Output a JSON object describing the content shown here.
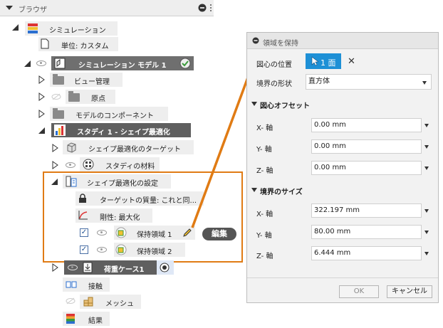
{
  "browser": {
    "title": "ブラウザ",
    "items": {
      "simulation": "シミュレーション",
      "units": "単位: カスタム",
      "model": "シミュレーション モデル 1",
      "view_mgmt": "ビュー管理",
      "origin": "原点",
      "model_components": "モデルのコンポーネント",
      "study": "スタディ 1 - シェイプ最適化",
      "shape_target": "シェイプ最適化のターゲット",
      "study_material": "スタディの材料",
      "shape_settings": "シェイプ最適化の設定",
      "target_mass": "ターゲットの質量: これと同...",
      "stiffness": "剛性: 最大化",
      "preserve1": "保持領域 1",
      "preserve2": "保持領域 2",
      "load_case": "荷重ケース1",
      "contact": "接触",
      "mesh": "メッシュ",
      "results": "結果"
    },
    "edit_callout": "編集",
    "check_mark": "✓"
  },
  "dialog": {
    "title": "領域を保持",
    "centroid_label": "図心の位置",
    "face_button": "1 面",
    "clear_symbol": "✕",
    "boundary_shape_label": "境界の形状",
    "boundary_shape_value": "直方体",
    "centroid_offset_header": "図心オフセット",
    "offset": {
      "x_label": "X- 軸",
      "x_value": "0.00 mm",
      "y_label": "Y- 軸",
      "y_value": "0.00 mm",
      "z_label": "Z- 軸",
      "z_value": "0.00 mm"
    },
    "boundary_size_header": "境界のサイズ",
    "size": {
      "x_label": "X- 軸",
      "x_value": "322.197 mm",
      "y_label": "Y- 軸",
      "y_value": "80.00 mm",
      "z_label": "Z- 軸",
      "z_value": "6.444 mm"
    },
    "ok_label": "OK",
    "cancel_label": "キャンセル"
  },
  "colors": {
    "accent_orange": "#e07b14",
    "selection_blue": "#1e90d6",
    "active_green": "#3a9a3a"
  }
}
